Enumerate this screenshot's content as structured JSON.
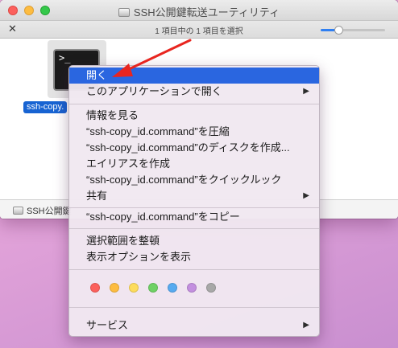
{
  "window": {
    "title": "SSH公開鍵転送ユーティリティ",
    "status": "1 項目中の 1 項目を選択",
    "zoom_level": 0.28,
    "path_label": "SSH公開鍵"
  },
  "file": {
    "name": "ssh-copy.",
    "icon_prompt": ">_"
  },
  "context_menu": {
    "items": [
      {
        "label": "開く",
        "highlighted": true
      },
      {
        "label": "このアプリケーションで開く",
        "submenu": true
      },
      {
        "label": "情報を見る"
      },
      {
        "label": "“ssh-copy_id.command”を圧縮"
      },
      {
        "label": "“ssh-copy_id.command”のディスクを作成..."
      },
      {
        "label": "エイリアスを作成"
      },
      {
        "label": "“ssh-copy_id.command”をクイックルック"
      },
      {
        "label": "共有",
        "submenu": true
      },
      {
        "label": "“ssh-copy_id.command”をコピー"
      },
      {
        "label": "選択範囲を整頓"
      },
      {
        "label": "表示オプションを表示"
      },
      {
        "label": "サービス",
        "submenu": true
      }
    ],
    "submenu_glyph": "▶",
    "tag_colors": [
      "#fc605c",
      "#fdbc40",
      "#fddc5c",
      "#6fd165",
      "#57aaf0",
      "#c38fdf",
      "#a8a8a8"
    ],
    "highlight_color": "#2a66e0"
  },
  "annotation": {
    "arrow_color": "#e8251f"
  }
}
